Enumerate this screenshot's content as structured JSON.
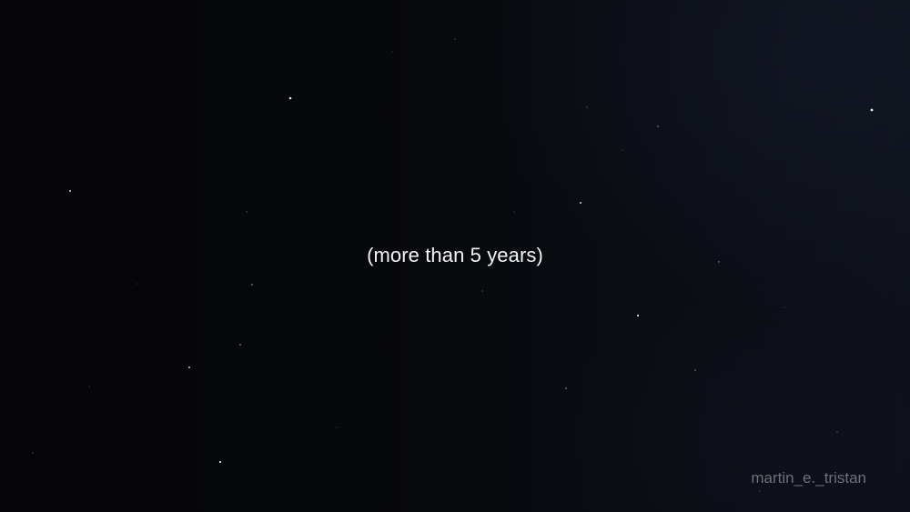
{
  "caption": "(more than 5 years)",
  "watermark": "martin_e._tristan",
  "colors": {
    "background": "#07080c",
    "caption_text": "#f2f3f5",
    "watermark_text": "#6e7178",
    "star": "#ffffff"
  }
}
